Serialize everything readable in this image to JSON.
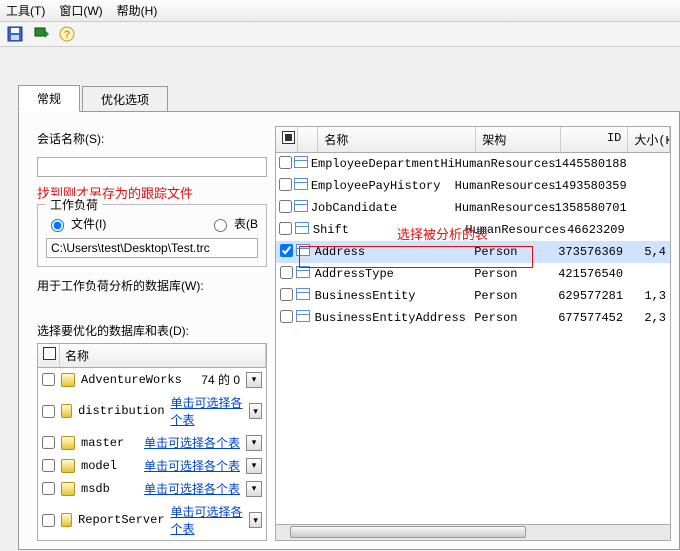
{
  "menu": {
    "tools": "工具(T)",
    "window": "窗口(W)",
    "help": "帮助(H)"
  },
  "tabs": {
    "general": "常规",
    "optimize": "优化选项"
  },
  "left": {
    "session_label": "会话名称(S):",
    "annot1": "找到刚才另存为的跟踪文件",
    "group_title": "工作负荷",
    "radio_file": "文件(I)",
    "radio_table": "表(B",
    "path_value": "C:\\Users\\test\\Desktop\\Test.trc",
    "db_label": "用于工作负荷分析的数据库(W):",
    "optimize_label": "选择要优化的数据库和表(D):",
    "db_head_name": "名称",
    "databases": [
      {
        "name": "AdventureWorks",
        "count": "74 的 0",
        "arrow_red": true
      },
      {
        "name": "distribution",
        "link": "单击可选择各个表"
      },
      {
        "name": "master",
        "link": "单击可选择各个表"
      },
      {
        "name": "model",
        "link": "单击可选择各个表"
      },
      {
        "name": "msdb",
        "link": "单击可选择各个表"
      },
      {
        "name": "ReportServer",
        "link": "单击可选择各个表"
      }
    ]
  },
  "right": {
    "annot2": "选择被分析的表",
    "head": {
      "name": "名称",
      "schema": "架构",
      "id": "ID",
      "size": "大小(KB"
    },
    "rows": [
      {
        "chk": false,
        "name": "EmployeeDepartmentHistory",
        "schema": "HumanResources",
        "id": "1445580188",
        "size": ""
      },
      {
        "chk": false,
        "name": "EmployeePayHistory",
        "schema": "HumanResources",
        "id": "1493580359",
        "size": ""
      },
      {
        "chk": false,
        "name": "JobCandidate",
        "schema": "HumanResources",
        "id": "1358580701",
        "size": ""
      },
      {
        "chk": false,
        "name": "Shift",
        "schema": "HumanResources",
        "id": "46623209",
        "size": ""
      },
      {
        "chk": true,
        "name": "Address",
        "schema": "Person",
        "id": "373576369",
        "size": "5,4",
        "selected": true
      },
      {
        "chk": false,
        "name": "AddressType",
        "schema": "Person",
        "id": "421576540",
        "size": ""
      },
      {
        "chk": false,
        "name": "BusinessEntity",
        "schema": "Person",
        "id": "629577281",
        "size": "1,3"
      },
      {
        "chk": false,
        "name": "BusinessEntityAddress",
        "schema": "Person",
        "id": "677577452",
        "size": "2,3"
      }
    ]
  }
}
